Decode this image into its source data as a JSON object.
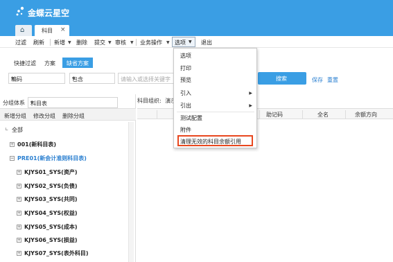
{
  "brand": {
    "name": "金蝶云星空"
  },
  "tabs": {
    "home_icon": "home-icon",
    "active_label": "科目",
    "close_label": "×"
  },
  "toolbar": {
    "items": [
      "过滤",
      "刷新",
      "新增",
      "删除",
      "提交",
      "审核",
      "业务操作",
      "选项",
      "退出"
    ],
    "caret": "▼"
  },
  "filter": {
    "tabs": [
      "快捷过滤",
      "方案",
      "缺省方案"
    ],
    "field_value": "编码",
    "operator_value": "包含",
    "search_placeholder": "请输入或选择关键字",
    "search_button": "搜索",
    "save_link": "保存",
    "reset_link": "重置"
  },
  "left": {
    "group_label": "分组体系",
    "group_value": "科目表",
    "ops": [
      "新增分组",
      "修改分组",
      "删除分组"
    ],
    "tree": [
      {
        "label": "全部",
        "level": 0,
        "icon": "□"
      },
      {
        "label": "001(新科目表)",
        "level": 1,
        "icon": "+"
      },
      {
        "label": "PRE01(新会计准则科目表)",
        "level": 1,
        "icon": "−",
        "highlight": true
      },
      {
        "label": "KJYS01_SYS(资产)",
        "level": 2,
        "icon": "+"
      },
      {
        "label": "KJYS02_SYS(负债)",
        "level": 2,
        "icon": "+"
      },
      {
        "label": "KJYS03_SYS(共同)",
        "level": 2,
        "icon": "+"
      },
      {
        "label": "KJYS04_SYS(权益)",
        "level": 2,
        "icon": "+"
      },
      {
        "label": "KJYS05_SYS(成本)",
        "level": 2,
        "icon": "+"
      },
      {
        "label": "KJYS06_SYS(损益)",
        "level": 2,
        "icon": "+"
      },
      {
        "label": "KJYS07_SYS(表外科目)",
        "level": 2,
        "icon": "+"
      }
    ]
  },
  "grid": {
    "group_label": "科目组织:",
    "group_value": "演示",
    "columns": [
      "助记码",
      "全名",
      "余额方向"
    ]
  },
  "menu": {
    "items": [
      {
        "label": "选项",
        "arrow": false
      },
      {
        "label": "打印",
        "arrow": false
      },
      {
        "label": "预览",
        "arrow": false
      },
      {
        "label": "引入",
        "arrow": true
      },
      {
        "label": "引出",
        "arrow": true
      },
      {
        "label": "测试配置",
        "arrow": false
      },
      {
        "label": "附件",
        "arrow": false
      },
      {
        "label": "清理无效的科目余额引用",
        "arrow": false,
        "highlighted": true
      }
    ],
    "arrow_glyph": "▶",
    "highlight_color": "#e8471e"
  },
  "colors": {
    "brand": "#3a9ee4",
    "link": "#2a7fd0"
  }
}
